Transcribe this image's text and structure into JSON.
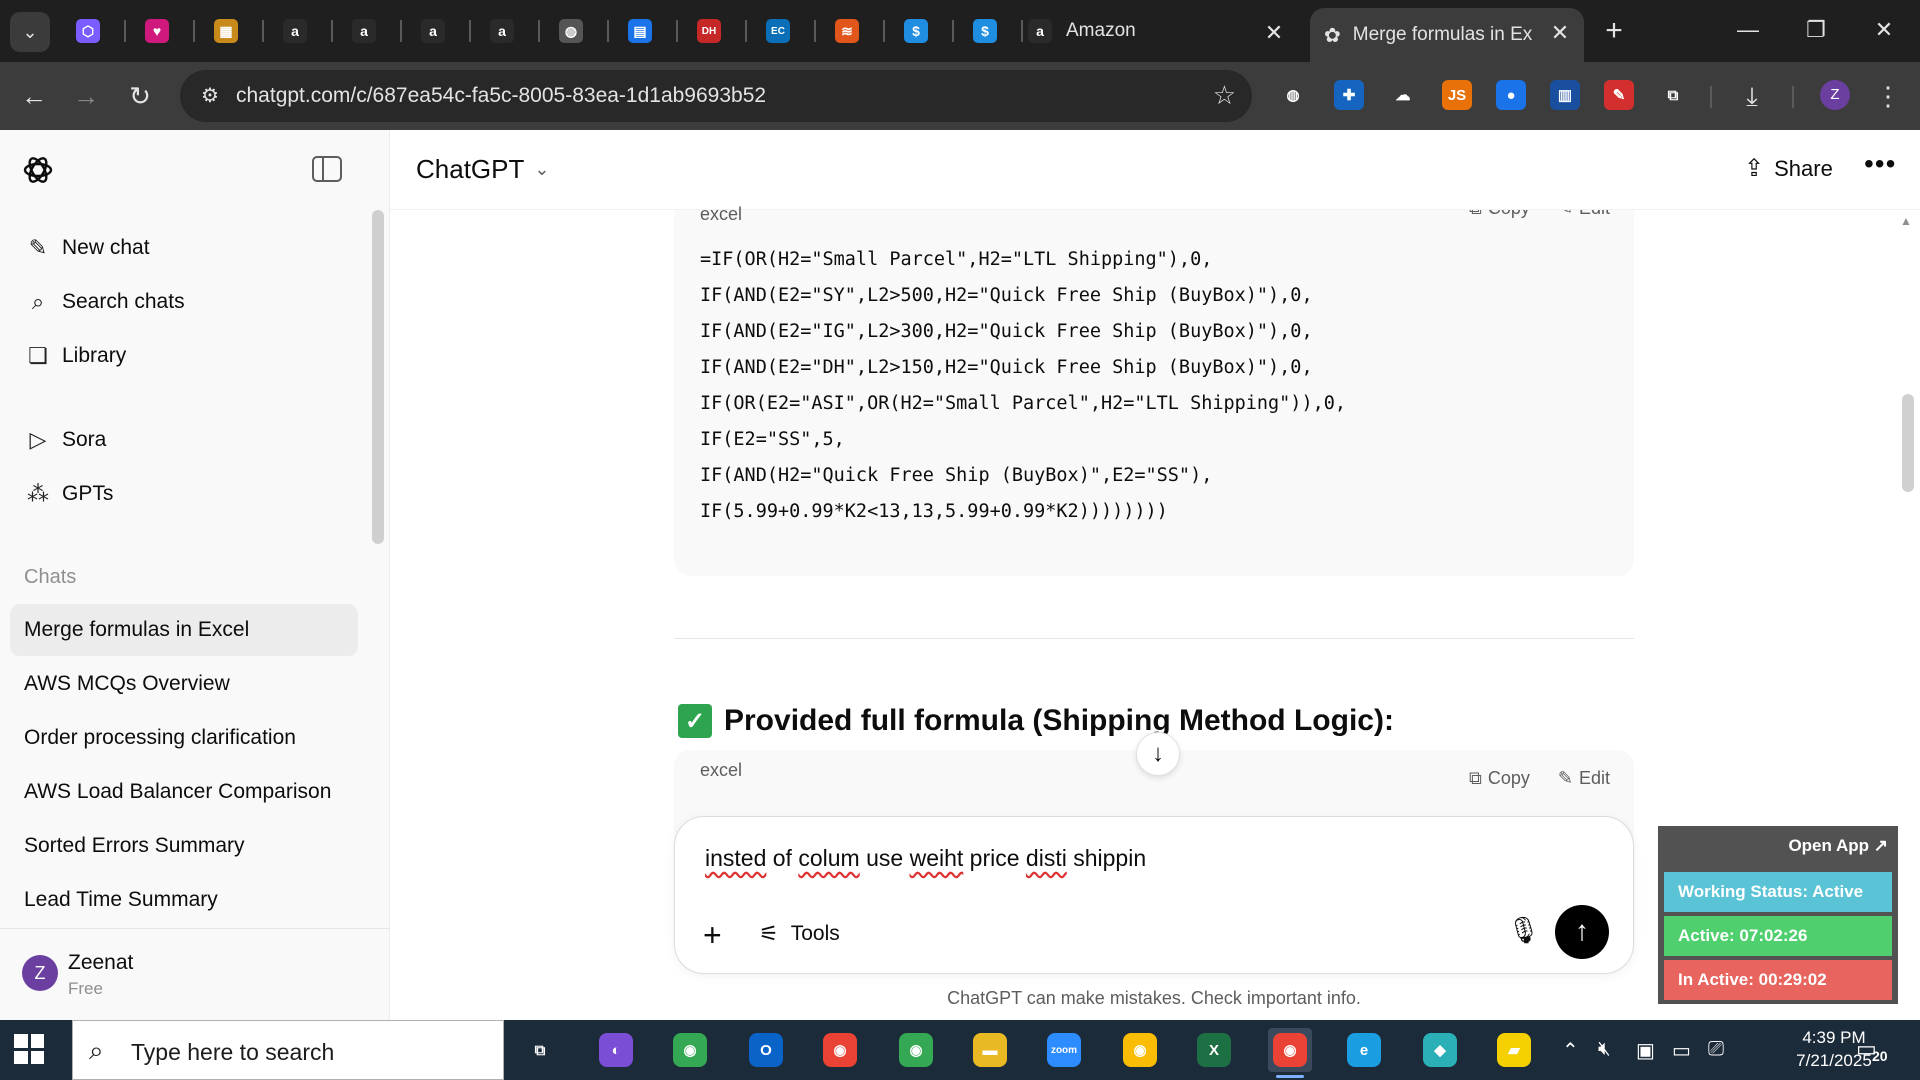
{
  "browser": {
    "favicon_tabs": [
      {
        "icon": "cube-icon",
        "color": "#7b5cff",
        "glyph": "⬡"
      },
      {
        "icon": "heart-app-icon",
        "color": "#d0197c",
        "glyph": "♥"
      },
      {
        "icon": "box-icon",
        "color": "#c98a1c",
        "glyph": "▦"
      },
      {
        "icon": "amazon-icon",
        "color": "#2a2a2a",
        "glyph": "a"
      },
      {
        "icon": "amazon-icon",
        "color": "#2a2a2a",
        "glyph": "a"
      },
      {
        "icon": "amazon-icon",
        "color": "#2a2a2a",
        "glyph": "a"
      },
      {
        "icon": "amazon-icon",
        "color": "#2a2a2a",
        "glyph": "a"
      },
      {
        "icon": "globe-icon",
        "color": "#555555",
        "glyph": "◍"
      },
      {
        "icon": "docs-icon",
        "color": "#1a73e8",
        "glyph": "▤"
      },
      {
        "icon": "dh-icon",
        "color": "#c62828",
        "glyph": "DH"
      },
      {
        "icon": "ec-icon",
        "color": "#0b6fb8",
        "glyph": "EC"
      },
      {
        "icon": "stack-icon",
        "color": "#e0561b",
        "glyph": "≋"
      },
      {
        "icon": "dollar-icon",
        "color": "#1f8de0",
        "glyph": "$"
      },
      {
        "icon": "dollar-icon",
        "color": "#1f8de0",
        "glyph": "$"
      }
    ],
    "tabs": [
      {
        "title": "Amazon",
        "icon": "amazon-icon"
      },
      {
        "title": "Merge formulas in Exc",
        "icon": "chatgpt-icon",
        "active": true
      }
    ],
    "url": "chatgpt.com/c/687ea54c-fa5c-8005-83ea-1d1ab9693b52",
    "extensions": [
      {
        "icon": "globe-ext-icon",
        "color": "#3c3c3c",
        "glyph": "◍"
      },
      {
        "icon": "plus-ext-icon",
        "color": "#1565c0",
        "glyph": "✚"
      },
      {
        "icon": "cloud-ext-icon",
        "color": "#3c3c3c",
        "glyph": "☁"
      },
      {
        "icon": "js-ext-icon",
        "color": "#e8710a",
        "glyph": "JS"
      },
      {
        "icon": "circle-ext-icon",
        "color": "#1a73e8",
        "glyph": "●"
      },
      {
        "icon": "chart-ext-icon",
        "color": "#1a4fa0",
        "glyph": "▥"
      },
      {
        "icon": "pen-ext-icon",
        "color": "#d32f2f",
        "glyph": "✎"
      },
      {
        "icon": "puzzle-icon",
        "color": "#3c3c3c",
        "glyph": "⧉"
      }
    ],
    "profile_initial": "Z"
  },
  "sidebar": {
    "primary": [
      {
        "label": "New chat",
        "icon": "new-chat-icon",
        "glyph": "✎"
      },
      {
        "label": "Search chats",
        "icon": "search-icon",
        "glyph": "⌕"
      },
      {
        "label": "Library",
        "icon": "library-icon",
        "glyph": "❏"
      }
    ],
    "secondary": [
      {
        "label": "Sora",
        "icon": "sora-icon",
        "glyph": "▷"
      },
      {
        "label": "GPTs",
        "icon": "gpts-icon",
        "glyph": "⁂"
      }
    ],
    "chats_heading": "Chats",
    "chats": [
      {
        "label": "Merge formulas in Excel",
        "active": true
      },
      {
        "label": "AWS MCQs Overview"
      },
      {
        "label": "Order processing clarification"
      },
      {
        "label": "AWS Load Balancer Comparison"
      },
      {
        "label": "Sorted Errors Summary"
      },
      {
        "label": "Lead Time Summary"
      }
    ],
    "user": {
      "initial": "Z",
      "name": "Zeenat",
      "plan": "Free"
    }
  },
  "header": {
    "model": "ChatGPT",
    "share_label": "Share"
  },
  "code_block_1": {
    "language": "excel",
    "copy_label": "Copy",
    "edit_label": "Edit",
    "lines": [
      "=IF(OR(H2=\"Small Parcel\",H2=\"LTL Shipping\"),0,",
      "IF(AND(E2=\"SY\",L2>500,H2=\"Quick Free Ship (BuyBox)\"),0,",
      "IF(AND(E2=\"IG\",L2>300,H2=\"Quick Free Ship (BuyBox)\"),0,",
      "IF(AND(E2=\"DH\",L2>150,H2=\"Quick Free Ship (BuyBox)\"),0,",
      "IF(OR(E2=\"ASI\",OR(H2=\"Small Parcel\",H2=\"LTL Shipping\")),0,",
      "IF(E2=\"SS\",5,",
      "IF(AND(H2=\"Quick Free Ship (BuyBox)\",E2=\"SS\"),",
      "IF(5.99+0.99*K2<13,13,5.99+0.99*K2))))))))"
    ]
  },
  "section_heading": "Provided full formula (Shipping Method Logic):",
  "code_block_2": {
    "language": "excel",
    "copy_label": "Copy",
    "edit_label": "Edit"
  },
  "composer": {
    "words": [
      {
        "text": "insted",
        "misspelled": true
      },
      {
        "text": "of",
        "misspelled": false
      },
      {
        "text": "colum",
        "misspelled": true
      },
      {
        "text": "use",
        "misspelled": false
      },
      {
        "text": "weiht",
        "misspelled": true
      },
      {
        "text": "price",
        "misspelled": false
      },
      {
        "text": "disti",
        "misspelled": true
      },
      {
        "text": "shippin",
        "misspelled": false
      }
    ],
    "tools_label": "Tools"
  },
  "disclaimer": "ChatGPT can make mistakes. Check important info.",
  "tracker": {
    "open_label": "Open App ↗",
    "working_status": "Working Status: Active",
    "active_time": "Active: 07:02:26",
    "inactive_time": "In Active: 00:29:02",
    "colors": {
      "status": "#5bc3d6",
      "active": "#4fcf6e",
      "inactive": "#e8645e"
    }
  },
  "taskbar": {
    "search_placeholder": "Type here to search",
    "apps": [
      {
        "icon": "task-view-icon",
        "color": "#1c2b3a",
        "glyph": "⧉"
      },
      {
        "icon": "copilot-icon",
        "color": "#7a4fd6",
        "glyph": "◐"
      },
      {
        "icon": "chrome-profile-icon",
        "color": "#34a853",
        "glyph": "◉"
      },
      {
        "icon": "outlook-icon",
        "color": "#0a64c8",
        "glyph": "O"
      },
      {
        "icon": "chrome-profile-icon",
        "color": "#ea4335",
        "glyph": "◉"
      },
      {
        "icon": "chrome-profile-icon",
        "color": "#34a853",
        "glyph": "◉"
      },
      {
        "icon": "file-explorer-icon",
        "color": "#e8b923",
        "glyph": "▬"
      },
      {
        "icon": "zoom-icon",
        "color": "#2d8cff",
        "glyph": "zoom"
      },
      {
        "icon": "chrome-icon",
        "color": "#fbbc05",
        "glyph": "◉"
      },
      {
        "icon": "excel-icon",
        "color": "#1d7044",
        "glyph": "X"
      },
      {
        "icon": "chrome-active-icon",
        "color": "#ea4335",
        "glyph": "◉",
        "active": true
      },
      {
        "icon": "edge-icon",
        "color": "#1b9de2",
        "glyph": "e"
      },
      {
        "icon": "app-diamond-icon",
        "color": "#2bb0b8",
        "glyph": "◆"
      },
      {
        "icon": "sticky-notes-icon",
        "color": "#f5d000",
        "glyph": "▰"
      }
    ],
    "time": "4:39 PM",
    "date": "7/21/2025",
    "notification_count": "20"
  }
}
